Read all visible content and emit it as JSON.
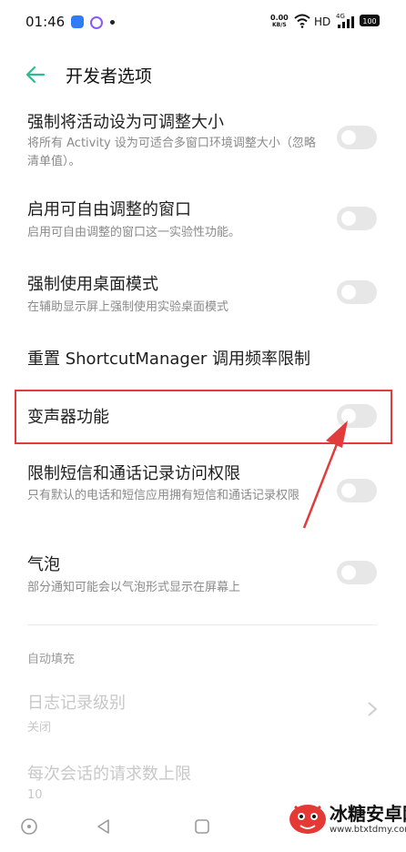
{
  "status_bar": {
    "time": "01:46",
    "net_speed_value": "0.00",
    "net_speed_unit": "KB/S",
    "hd_label": "HD",
    "signal_label": "4G",
    "battery_level": "100"
  },
  "header": {
    "title": "开发者选项"
  },
  "settings": [
    {
      "title": "强制将活动设为可调整大小",
      "subtitle": "将所有 Activity 设为可适合多窗口环境调整大小（忽略清单值）。",
      "toggle_on": false
    },
    {
      "title": "启用可自由调整的窗口",
      "subtitle": "启用可自由调整的窗口这一实验性功能。",
      "toggle_on": false
    },
    {
      "title": "强制使用桌面模式",
      "subtitle": "在辅助显示屏上强制使用实验桌面模式",
      "toggle_on": false
    },
    {
      "title": "重置 ShortcutManager 调用频率限制"
    },
    {
      "title": "变声器功能",
      "toggle_on": false
    },
    {
      "title": "限制短信和通话记录访问权限",
      "subtitle": "只有默认的电话和短信应用拥有短信和通话记录权限",
      "toggle_on": false
    },
    {
      "title": "气泡",
      "subtitle": "部分通知可能会以气泡形式显示在屏幕上",
      "toggle_on": false
    }
  ],
  "autofill": {
    "section_header": "自动填充",
    "items": [
      {
        "title": "日志记录级别",
        "value": "关闭"
      },
      {
        "title": "每次会话的请求数上限",
        "value": "10"
      }
    ]
  },
  "watermark": {
    "title": "冰糖安卓网",
    "url": "www.btxtdmy.com"
  },
  "colors": {
    "accent": "#2bbd8e",
    "highlight": "#e23b3b",
    "toggle_off": "#e7e7e7"
  }
}
